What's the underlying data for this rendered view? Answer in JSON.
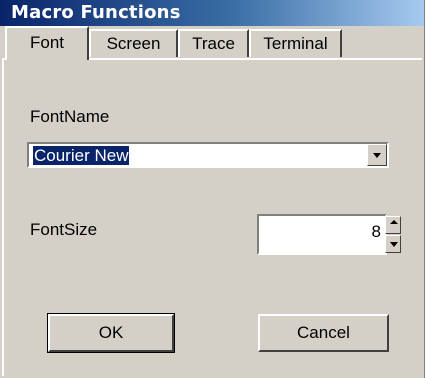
{
  "window": {
    "title": "Macro Functions"
  },
  "tabs": [
    {
      "label": "Font",
      "active": true
    },
    {
      "label": "Screen",
      "active": false
    },
    {
      "label": "Trace",
      "active": false
    },
    {
      "label": "Terminal",
      "active": false
    }
  ],
  "font_name": {
    "label": "FontName",
    "value": "Courier New"
  },
  "font_size": {
    "label": "FontSize",
    "value": "8"
  },
  "buttons": {
    "ok": "OK",
    "cancel": "Cancel"
  },
  "colors": {
    "title_start": "#0a246a",
    "title_end": "#a6caf0",
    "face": "#d4d0c8",
    "selection": "#0a246a"
  }
}
